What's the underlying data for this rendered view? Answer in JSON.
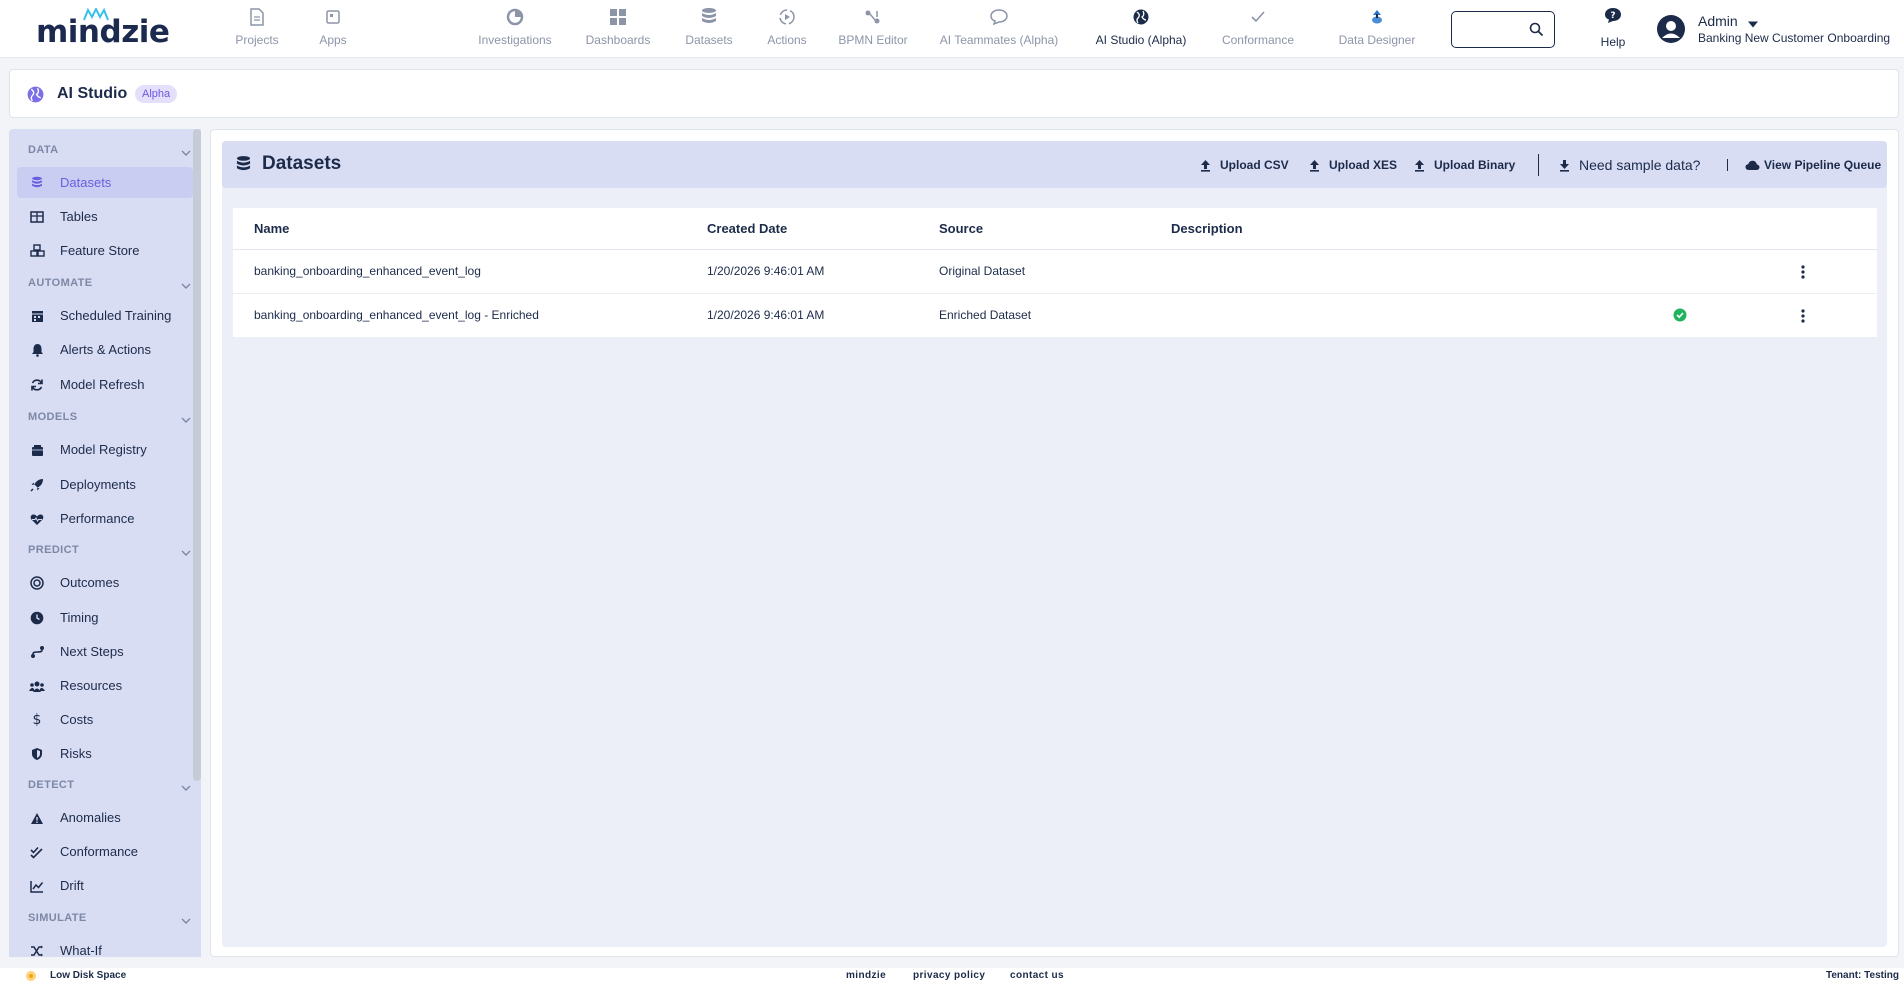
{
  "brand": {
    "logo_text": "mindzie"
  },
  "topnav": {
    "items": [
      {
        "label": "Projects",
        "icon": "document-icon"
      },
      {
        "label": "Apps",
        "icon": "apps-icon"
      },
      {
        "label": "Investigations",
        "icon": "investigations-icon"
      },
      {
        "label": "Dashboards",
        "icon": "dashboards-icon"
      },
      {
        "label": "Datasets",
        "icon": "database-icon"
      },
      {
        "label": "Actions",
        "icon": "actions-icon"
      },
      {
        "label": "BPMN Editor",
        "icon": "bpmn-icon"
      },
      {
        "label": "AI Teammates (Alpha)",
        "icon": "chat-icon"
      },
      {
        "label": "AI Studio (Alpha)",
        "icon": "globe-icon"
      },
      {
        "label": "Conformance",
        "icon": "check-icon"
      },
      {
        "label": "Data Designer",
        "icon": "data-designer-icon"
      }
    ],
    "active": "AI Studio (Alpha)",
    "search_placeholder": "",
    "help_label": "Help",
    "user_name": "Admin",
    "project_name": "Banking New Customer Onboarding"
  },
  "page": {
    "title": "AI Studio",
    "badge": "Alpha"
  },
  "sidebar": {
    "sections": [
      {
        "title": "DATA",
        "items": [
          {
            "label": "Datasets",
            "icon": "database-icon",
            "active": true
          },
          {
            "label": "Tables",
            "icon": "table-icon"
          },
          {
            "label": "Feature Store",
            "icon": "cubes-icon"
          }
        ]
      },
      {
        "title": "AUTOMATE",
        "items": [
          {
            "label": "Scheduled Training",
            "icon": "calendar-icon"
          },
          {
            "label": "Alerts & Actions",
            "icon": "bell-icon"
          },
          {
            "label": "Model Refresh",
            "icon": "refresh-icon"
          }
        ]
      },
      {
        "title": "MODELS",
        "items": [
          {
            "label": "Model Registry",
            "icon": "registry-icon"
          },
          {
            "label": "Deployments",
            "icon": "rocket-icon"
          },
          {
            "label": "Performance",
            "icon": "heartbeat-icon"
          }
        ]
      },
      {
        "title": "PREDICT",
        "items": [
          {
            "label": "Outcomes",
            "icon": "target-icon"
          },
          {
            "label": "Timing",
            "icon": "clock-icon"
          },
          {
            "label": "Next Steps",
            "icon": "steps-icon"
          },
          {
            "label": "Resources",
            "icon": "users-icon"
          },
          {
            "label": "Costs",
            "icon": "dollar-icon"
          },
          {
            "label": "Risks",
            "icon": "shield-icon"
          }
        ]
      },
      {
        "title": "DETECT",
        "items": [
          {
            "label": "Anomalies",
            "icon": "warning-icon"
          },
          {
            "label": "Conformance",
            "icon": "double-check-icon"
          },
          {
            "label": "Drift",
            "icon": "line-chart-icon"
          }
        ]
      },
      {
        "title": "SIMULATE",
        "items": [
          {
            "label": "What-If",
            "icon": "shuffle-icon"
          }
        ]
      }
    ]
  },
  "datasets": {
    "title": "Datasets",
    "toolbar": {
      "upload_csv": "Upload CSV",
      "upload_xes": "Upload XES",
      "upload_binary": "Upload Binary",
      "sample_data": "Need sample data?",
      "pipeline_queue": "View Pipeline Queue"
    },
    "columns": {
      "name": "Name",
      "created": "Created Date",
      "source": "Source",
      "description": "Description"
    },
    "rows": [
      {
        "name": "banking_onboarding_enhanced_event_log",
        "created": "1/20/2026 9:46:01 AM",
        "source": "Original Dataset",
        "description": "",
        "ready": false
      },
      {
        "name": "banking_onboarding_enhanced_event_log - Enriched",
        "created": "1/20/2026 9:46:01 AM",
        "source": "Enriched Dataset",
        "description": "",
        "ready": true
      }
    ]
  },
  "footer": {
    "warning": "Low Disk Space",
    "links": [
      "mindzie",
      "privacy policy",
      "contact us"
    ],
    "tenant": "Tenant: Testing"
  },
  "colors": {
    "navy": "#1c2b4a",
    "accent": "#6a5ee0",
    "sidebar_bg": "#d9ddf3",
    "success": "#22b35e",
    "warning": "#f0a020"
  }
}
